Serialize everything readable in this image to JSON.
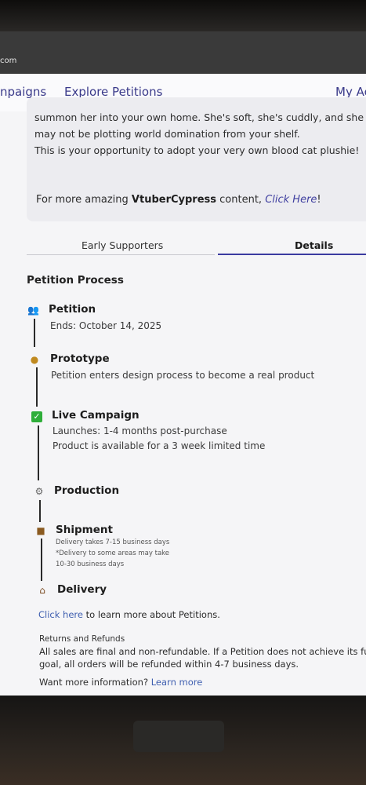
{
  "browser": {
    "url_fragment": "com"
  },
  "nav": {
    "items": [
      "npaigns",
      "Explore Petitions",
      "My Ac"
    ]
  },
  "description": {
    "lines": [
      "summon her into your own home. She's soft, she's cuddly, and she m",
      "may not be plotting world domination from your shelf.",
      "This is your opportunity to adopt your very own blood cat plushie!"
    ],
    "more_prefix": "For more amazing ",
    "more_brand": "VtuberCypress",
    "more_middle": " content, ",
    "more_link": "Click Here",
    "more_suffix": "!"
  },
  "tabs": {
    "items": [
      "Early Supporters",
      "Details"
    ],
    "active": "Details"
  },
  "process": {
    "title": "Petition Process",
    "steps": [
      {
        "icon": "people-icon",
        "title": "Petition",
        "lines": [
          "Ends: October 14, 2025"
        ]
      },
      {
        "icon": "lightbulb-icon",
        "title": "Prototype",
        "lines": [
          "Petition enters design process to become a real product"
        ]
      },
      {
        "icon": "checkmark-icon",
        "title": "Live Campaign",
        "lines": [
          "Launches: 1-4 months post-purchase",
          "Product is available for a 3 week limited time"
        ]
      },
      {
        "icon": "gear-icon",
        "title": "Production",
        "lines": []
      },
      {
        "icon": "package-icon",
        "title": "Shipment",
        "lines": [
          "Delivery takes 7-15 business days",
          "*Delivery to some areas may take",
          "10-30 business days"
        ]
      },
      {
        "icon": "house-icon",
        "title": "Delivery",
        "lines": []
      }
    ]
  },
  "learn_more": {
    "link": "Click here",
    "text": " to learn more about Petitions."
  },
  "returns": {
    "heading": "Returns and Refunds",
    "lines": [
      "All sales are final and non-refundable. If a Petition does not achieve its fun",
      "goal, all orders will be refunded within 4-7 business days."
    ]
  },
  "want_more": {
    "text": "Want more information? ",
    "link": "Learn more"
  },
  "colors": {
    "accent": "#3a3aa0",
    "link": "#3f5fb0",
    "check_green": "#2fae3a"
  }
}
